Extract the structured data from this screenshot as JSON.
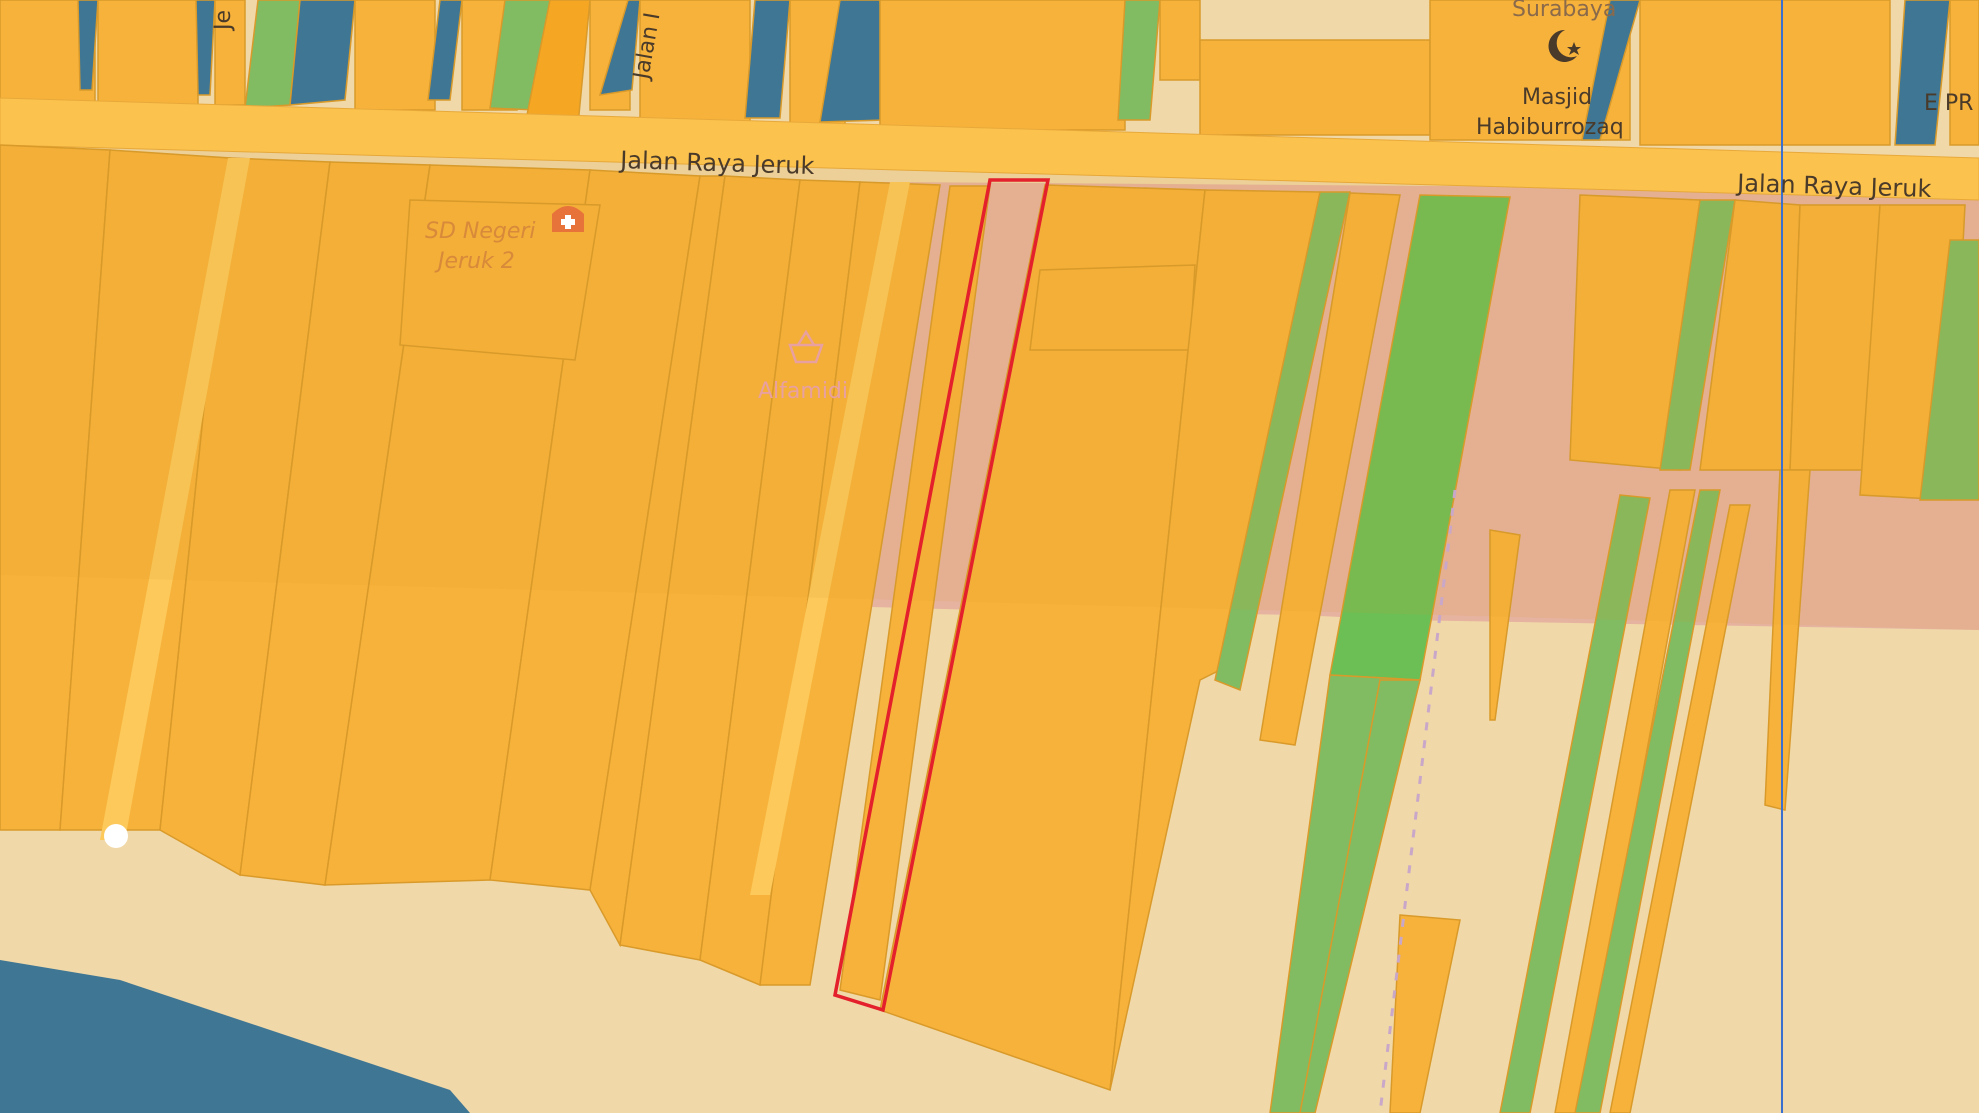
{
  "map": {
    "roads": [
      {
        "name": "Jalan Raya Jeruk"
      },
      {
        "name": "Jalan Raya Jeruk"
      },
      {
        "name": "Jalan I"
      },
      {
        "name": "Je"
      }
    ],
    "pois": [
      {
        "name": "SD Negeri",
        "name2": "Jeruk 2",
        "icon": "school-icon"
      },
      {
        "name": "Alfamidi",
        "icon": "shop-basket-icon"
      },
      {
        "name": "Masjid",
        "name2": "Habiburrozaq",
        "icon": "mosque-icon"
      }
    ],
    "partial_labels": [
      "Surabaya",
      "E PR"
    ],
    "selected_parcel": {
      "highlight_color": "#e3202b"
    },
    "colors": {
      "land": "#f0d8a8",
      "parcel": "#f7b23b",
      "parcel_edge": "#d99a2a",
      "green": "#6cbf55",
      "blue": "#3f7694",
      "road": "#fbc24d",
      "pink": "#e6b3a0",
      "poi_text": "#d8893a"
    }
  }
}
